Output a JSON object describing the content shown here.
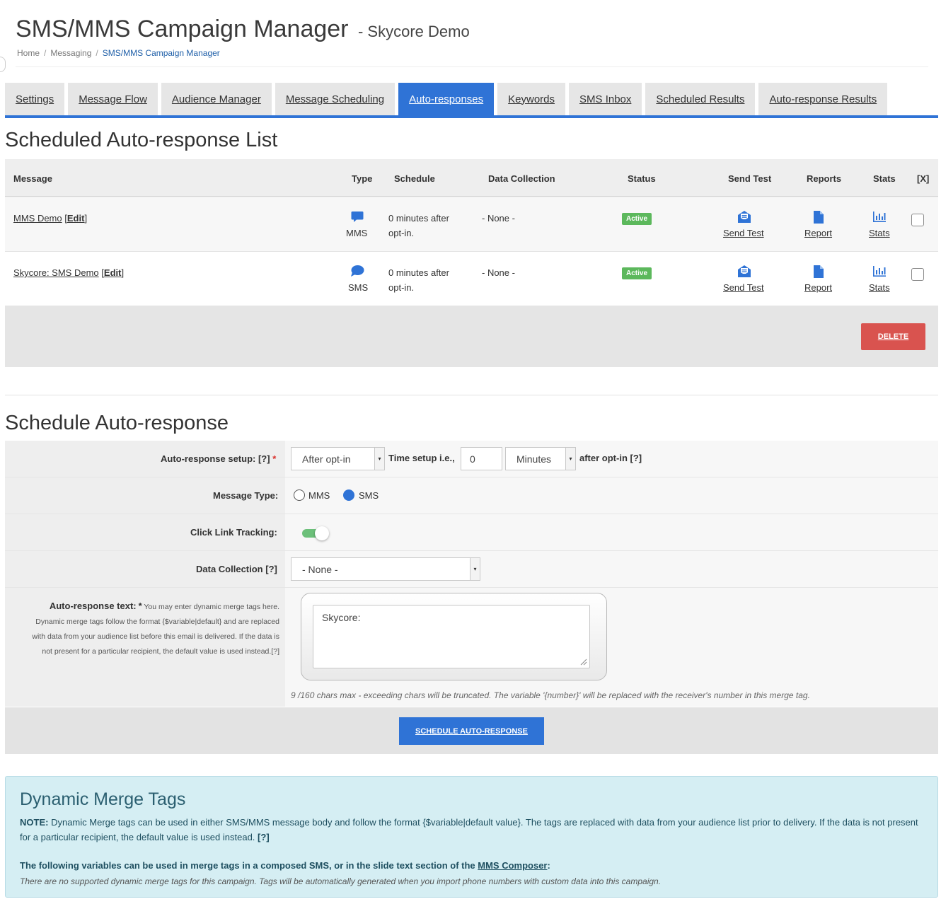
{
  "header": {
    "title": "SMS/MMS Campaign Manager",
    "subtitle": "- Skycore Demo",
    "breadcrumb": [
      "Home",
      "Messaging",
      "SMS/MMS Campaign Manager"
    ]
  },
  "tabs": [
    {
      "label": "Settings"
    },
    {
      "label": "Message Flow"
    },
    {
      "label": "Audience Manager"
    },
    {
      "label": "Message Scheduling"
    },
    {
      "label": "Auto-responses",
      "active": true
    },
    {
      "label": "Keywords"
    },
    {
      "label": "SMS Inbox"
    },
    {
      "label": "Scheduled Results"
    },
    {
      "label": "Auto-response Results"
    }
  ],
  "list": {
    "heading": "Scheduled Auto-response List",
    "columns": [
      "Message",
      "Type",
      "Schedule",
      "Data Collection",
      "Status",
      "Send Test",
      "Reports",
      "Stats",
      "[X]"
    ],
    "rows": [
      {
        "message": "MMS Demo",
        "edit": "Edit",
        "type": "MMS",
        "schedule_line1": "0 minutes after",
        "schedule_line2": "opt-in.",
        "data_collection": "- None -",
        "status": "Active",
        "send_test": "Send Test",
        "report": "Report",
        "stats": "Stats"
      },
      {
        "message": "Skycore: SMS Demo",
        "edit": "Edit",
        "type": "SMS",
        "schedule_line1": "0 minutes after",
        "schedule_line2": "opt-in.",
        "data_collection": "- None -",
        "status": "Active",
        "send_test": "Send Test",
        "report": "Report",
        "stats": "Stats"
      }
    ],
    "delete_label": "DELETE"
  },
  "form": {
    "heading": "Schedule Auto-response",
    "setup_label": "Auto-response setup: [?]",
    "required_mark": "*",
    "setup_value": "After opt-in",
    "time_label": "Time setup i.e.,",
    "time_value": "0",
    "unit_value": "Minutes",
    "after_label": "after opt-in [?]",
    "message_type_label": "Message Type:",
    "message_type_options": [
      "MMS",
      "SMS"
    ],
    "message_type_selected": "SMS",
    "click_tracking_label": "Click Link Tracking:",
    "click_tracking_on": true,
    "data_collection_label": "Data Collection [?]",
    "data_collection_value": "- None -",
    "text_label": "Auto-response text:",
    "text_help_1": "You may enter dynamic merge tags here.",
    "text_help_2": "Dynamic merge tags follow the format {$variable|default} and are replaced",
    "text_help_3": "with data from your audience list before this email is delivered. If the data is",
    "text_help_4": "not present for a particular recipient, the default value is used instead.[?]",
    "text_value": "Skycore:",
    "chars_note": "9 /160 chars max - exceeding chars will be truncated. The variable '{number}' will be replaced with the receiver's number in this merge tag.",
    "submit_label": "SCHEDULE AUTO-RESPONSE"
  },
  "merge_tags": {
    "title": "Dynamic Merge Tags",
    "note_label": "NOTE:",
    "note_text": "Dynamic Merge tags can be used in either SMS/MMS message body and follow the format {$variable|default value}. The tags are replaced with data from your audience list prior to delivery. If the data is not present for a particular recipient, the default value is used instead.",
    "note_help": "[?]",
    "vars_text": "The following variables can be used in merge tags in a composed SMS, or in the slide text section of the",
    "vars_link": "MMS Composer",
    "vars_colon": ":",
    "none_text": "There are no supported dynamic merge tags for this campaign. Tags will be automatically generated when you import phone numbers with custom data into this campaign."
  },
  "colors": {
    "accent": "#2f73d6",
    "active_badge": "#5cb85c",
    "delete": "#d9534f",
    "info_bg": "#d5eef3"
  },
  "icons": {
    "mms_type": "speech-bubble-square-icon",
    "sms_type": "speech-bubble-round-icon",
    "send_test": "envelope-open-icon",
    "report": "document-icon",
    "stats": "bar-chart-icon"
  }
}
